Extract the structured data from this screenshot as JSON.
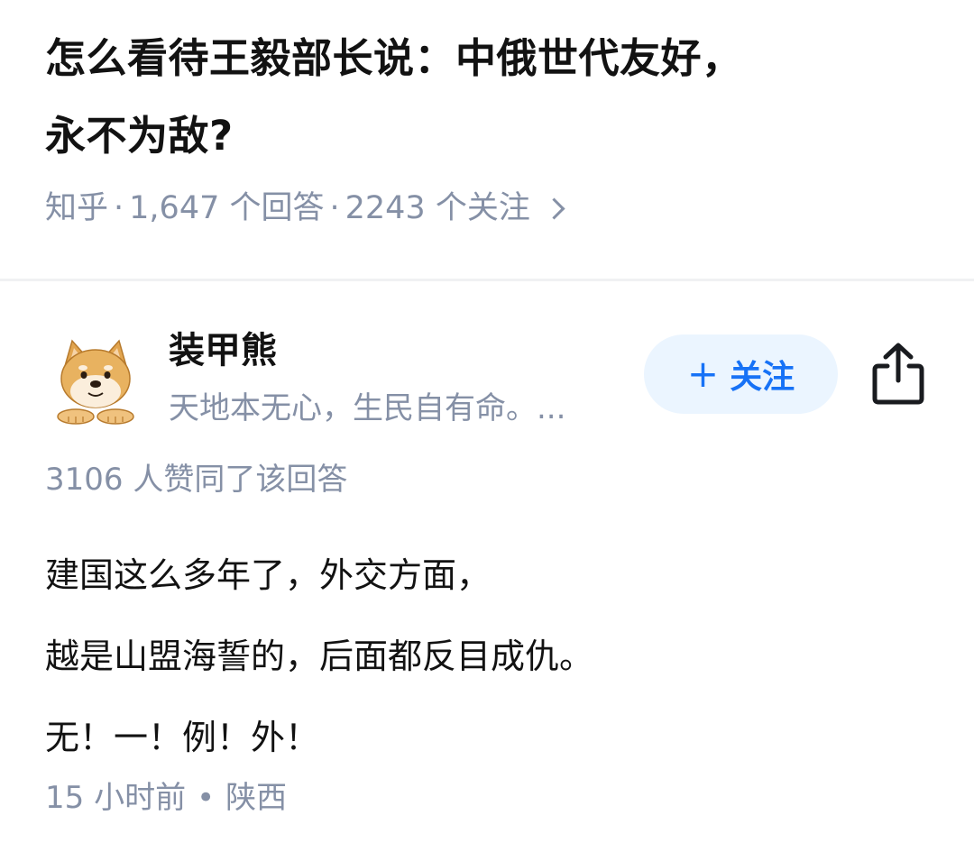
{
  "question": {
    "title_line1": "怎么看待王毅部长说：中俄世代友好，",
    "title_line2": "永不为敌?",
    "source": "知乎",
    "answers": "1,647 个回答",
    "followers": "2243 个关注",
    "separator": "·"
  },
  "answer": {
    "author": {
      "name": "装甲熊",
      "bio": "天地本无心，生民自有命。...",
      "avatar_icon": "doge-avatar-icon"
    },
    "follow_button": {
      "plus": "+",
      "label": "关注"
    },
    "share_icon": "share-icon",
    "votes": "3106 人赞同了该回答",
    "paragraphs": [
      "建国这么多年了，外交方面，",
      "越是山盟海誓的，后面都反目成仇。",
      "无！一！例！外！"
    ],
    "time": "15 小时前",
    "location": "陕西",
    "footer_separator": "•"
  },
  "colors": {
    "accent": "#1772f6",
    "accent_bg": "#ebf5ff",
    "meta_gray": "#8590a6",
    "text": "#121212"
  }
}
